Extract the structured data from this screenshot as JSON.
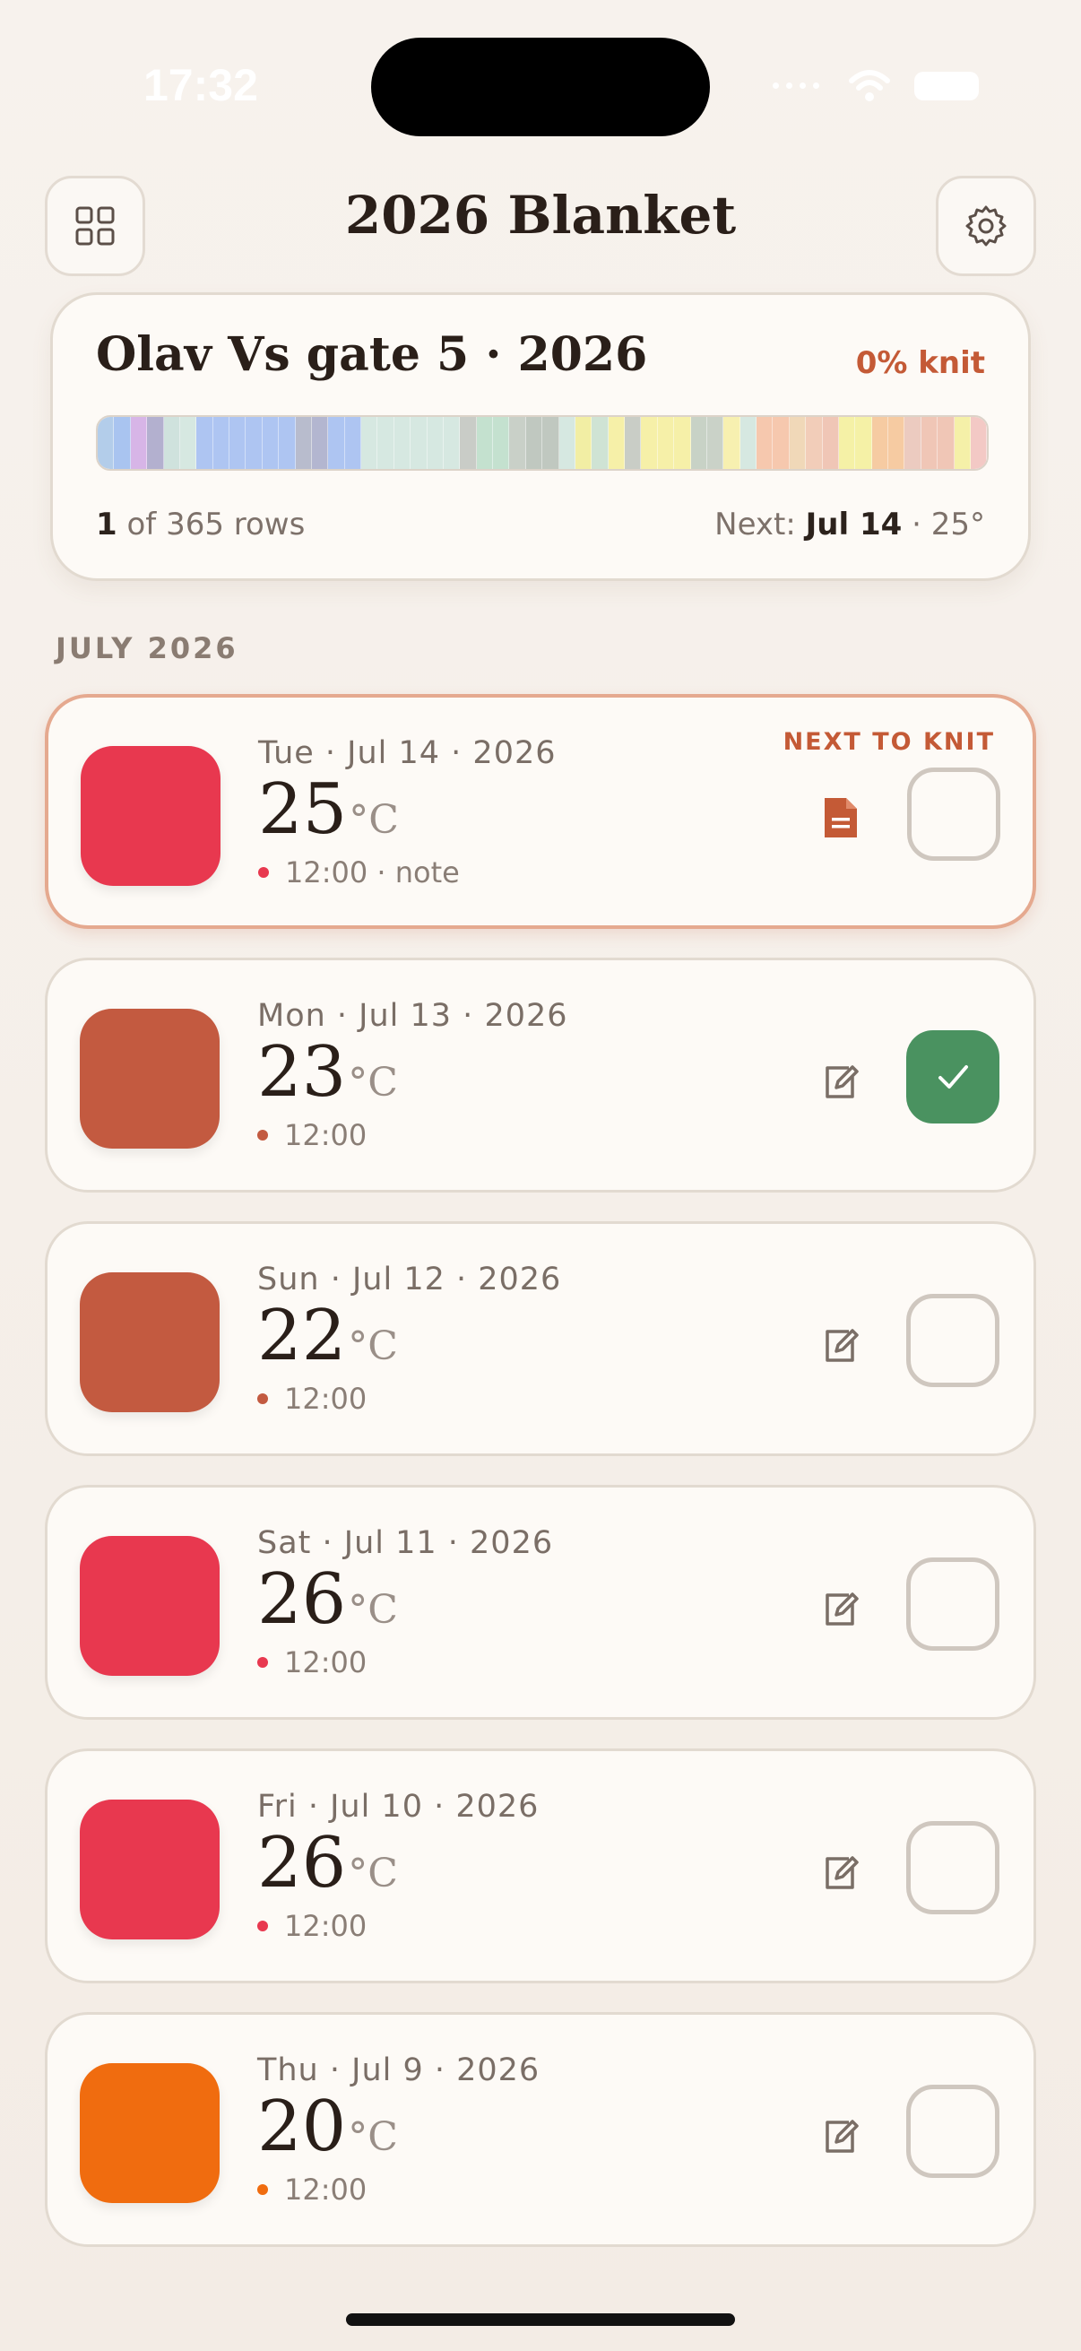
{
  "status": {
    "time": "17:32"
  },
  "header": {
    "title": "2026 Blanket"
  },
  "summary": {
    "title": "Olav Vs gate 5 · 2026",
    "percent_label": "0% knit",
    "rows_done": "1",
    "rows_total_label": "of 365 rows",
    "next_prefix": "Next:",
    "next_date": "Jul 14",
    "next_temp": "· 25°",
    "stripe_colors": [
      "#b3cdea",
      "#a9c4f0",
      "#d7b5e7",
      "#b3b0cf",
      "#cfe2dd",
      "#d6e8e1",
      "#aec5f2",
      "#aec5f2",
      "#aec5f2",
      "#aec5f2",
      "#aec5f2",
      "#aec5f2",
      "#b8bccd",
      "#b3b6d0",
      "#aec5f2",
      "#aec5f2",
      "#d6e8e1",
      "#d6e8e1",
      "#d6e8e1",
      "#d6e8e1",
      "#d6e8e1",
      "#d6e8e1",
      "#c9ccc7",
      "#c4e1cf",
      "#c4e1cf",
      "#c9d0c8",
      "#c0c8c0",
      "#c0c8c0",
      "#d6e8e1",
      "#f2eea4",
      "#cfe3d4",
      "#f6f0a8",
      "#c9cdc6",
      "#f6f0a8",
      "#f6f0a8",
      "#f6f0a8",
      "#c8d2c6",
      "#cad2c8",
      "#f7f0b0",
      "#d6e8e1",
      "#f6c8ae",
      "#f6c8ae",
      "#f0d8b8",
      "#f2cdb9",
      "#f0c6b6",
      "#f5f1a6",
      "#f5f1a6",
      "#f6cba2",
      "#f6cba2",
      "#eccbc0",
      "#f0c6b6",
      "#f0c6b6",
      "#f5f0a8",
      "#f3c9c5"
    ]
  },
  "month": {
    "label": "JULY 2026"
  },
  "days": [
    {
      "date": "Tue · Jul 14 · 2026",
      "temp": "25",
      "unit": "°C",
      "meta": "12:00 · note",
      "color": "#e8384f",
      "next_label": "NEXT TO KNIT",
      "done": false
    },
    {
      "date": "Mon · Jul 13 · 2026",
      "temp": "23",
      "unit": "°C",
      "meta": "12:00",
      "color": "#c35a40",
      "next_label": "",
      "done": true
    },
    {
      "date": "Sun · Jul 12 · 2026",
      "temp": "22",
      "unit": "°C",
      "meta": "12:00",
      "color": "#c35a40",
      "next_label": "",
      "done": false
    },
    {
      "date": "Sat · Jul 11 · 2026",
      "temp": "26",
      "unit": "°C",
      "meta": "12:00",
      "color": "#e8384f",
      "next_label": "",
      "done": false
    },
    {
      "date": "Fri · Jul 10 · 2026",
      "temp": "26",
      "unit": "°C",
      "meta": "12:00",
      "color": "#e8384f",
      "next_label": "",
      "done": false
    },
    {
      "date": "Thu · Jul 9 · 2026",
      "temp": "20",
      "unit": "°C",
      "meta": "12:00",
      "color": "#f06c0f",
      "next_label": "",
      "done": false
    }
  ],
  "icons": {
    "left_button": "grid-icon",
    "right_button": "gear-icon",
    "note": "note-icon",
    "edit": "edit-icon",
    "check": "checkmark-icon"
  }
}
